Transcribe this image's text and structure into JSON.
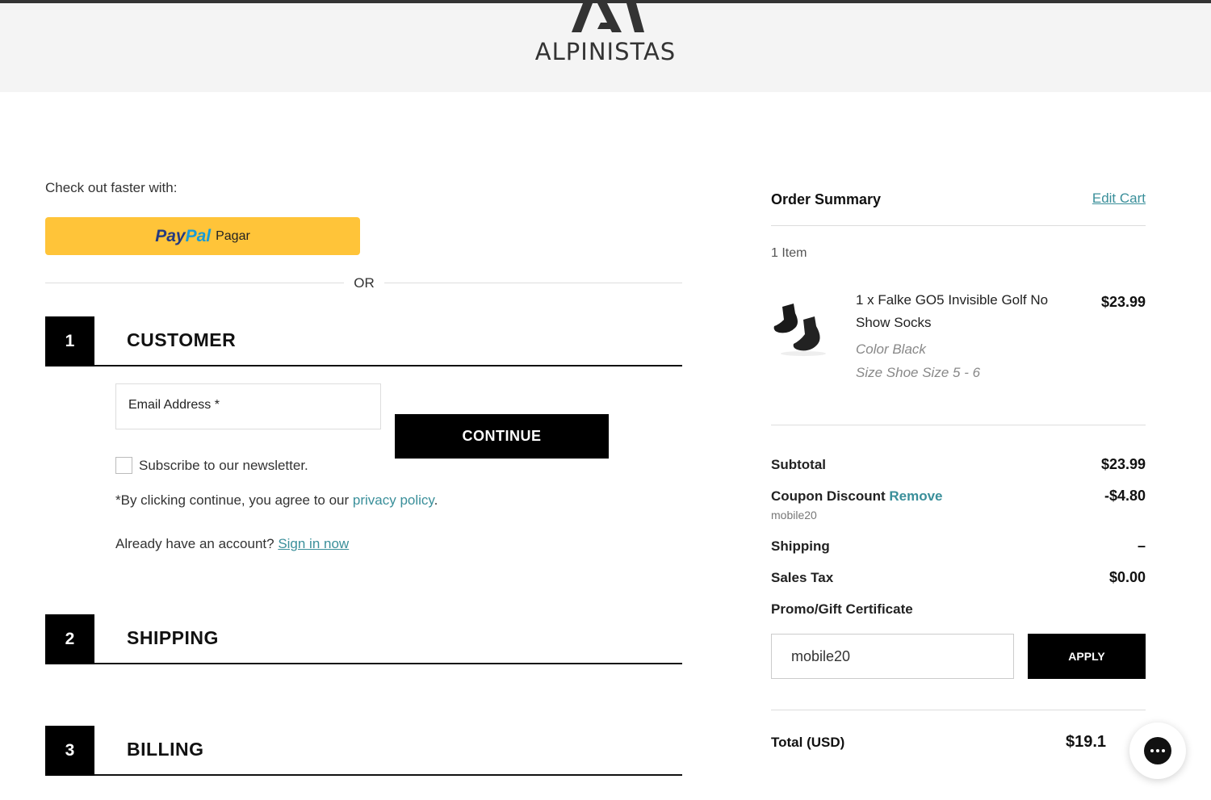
{
  "header": {
    "logo_text": "ALPINISTAS"
  },
  "checkout": {
    "fast_label": "Check out faster with:",
    "paypal": {
      "pay": "Pay",
      "pal": "Pal",
      "pagar": "Pagar",
      "color": "#ffc439"
    },
    "or_label": "OR",
    "steps": [
      {
        "number": "1",
        "title": "CUSTOMER"
      },
      {
        "number": "2",
        "title": "SHIPPING"
      },
      {
        "number": "3",
        "title": "BILLING"
      }
    ],
    "customer": {
      "email_placeholder": "Email Address *",
      "continue_label": "CONTINUE",
      "newsletter_label": "Subscribe to our newsletter.",
      "agree_prefix": "*By clicking continue, you agree to our ",
      "privacy_link": "privacy policy",
      "agree_suffix": ".",
      "account_prefix": "Already have an account? ",
      "signin_link": "Sign in now"
    }
  },
  "summary": {
    "title": "Order Summary",
    "edit_cart": "Edit Cart",
    "item_count": "1 Item",
    "product": {
      "name": "1 x Falke GO5 Invisible Golf No Show Socks",
      "price": "$23.99",
      "color_option": "Color Black",
      "size_option": "Size Shoe Size 5 - 6",
      "image_icon": "socks-icon"
    },
    "subtotal_label": "Subtotal",
    "subtotal_value": "$23.99",
    "coupon_label": "Coupon Discount ",
    "coupon_remove": "Remove",
    "coupon_value": "-$4.80",
    "coupon_code": "mobile20",
    "shipping_label": "Shipping",
    "shipping_value": "–",
    "tax_label": "Sales Tax",
    "tax_value": "$0.00",
    "promo_label": "Promo/Gift Certificate",
    "promo_value": "mobile20",
    "apply_label": "APPLY",
    "total_label": "Total (USD)",
    "total_value": "$19.1",
    "accent_color": "#3a8f9a"
  },
  "chat": {
    "icon": "chat-bubble-icon"
  }
}
